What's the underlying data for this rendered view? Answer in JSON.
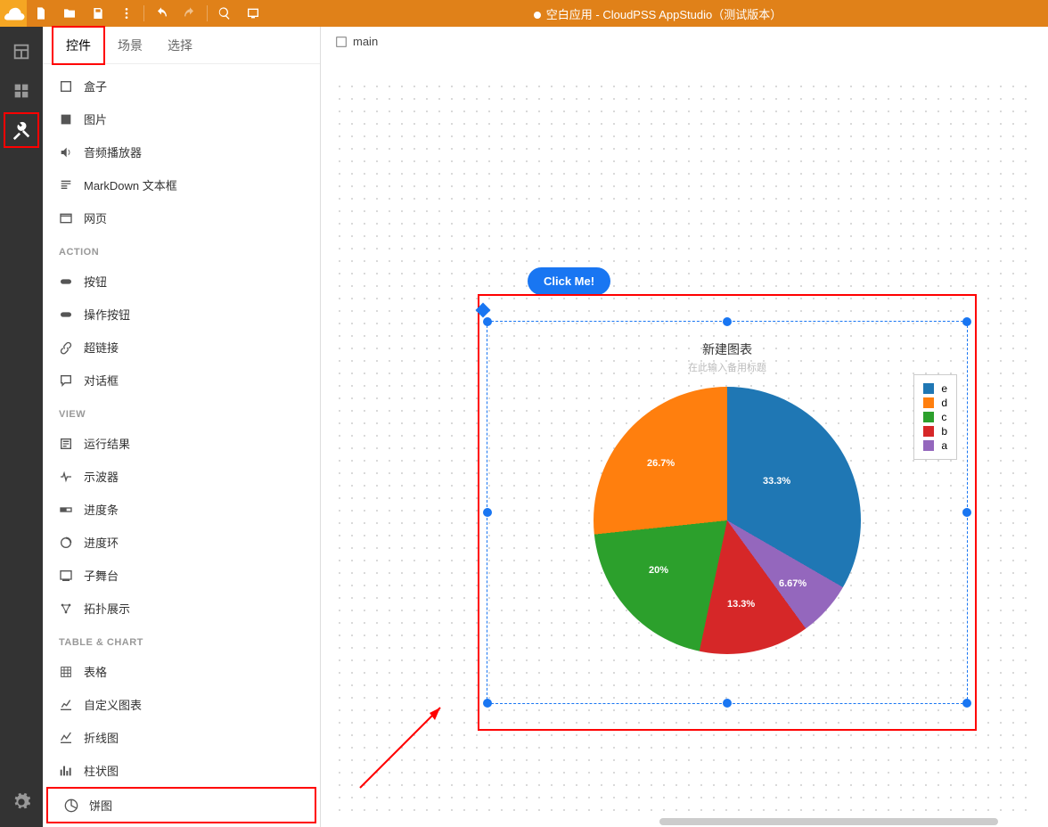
{
  "app_title": "空白应用 - CloudPSS AppStudio（测试版本）",
  "tabs": {
    "widgets": "控件",
    "scenes": "场景",
    "select": "选择"
  },
  "canvas_tab": "main",
  "click_me": "Click Me!",
  "groups": {
    "action": "ACTION",
    "view": "VIEW",
    "table": "TABLE & CHART"
  },
  "widgets": {
    "box": "盒子",
    "image": "图片",
    "audio": "音频播放器",
    "markdown": "MarkDown 文本框",
    "web": "网页",
    "button": "按钮",
    "opbutton": "操作按钮",
    "link": "超链接",
    "dialog": "对话框",
    "result": "运行结果",
    "scope": "示波器",
    "progressbar": "进度条",
    "progressring": "进度环",
    "substage": "子舞台",
    "topo": "拓扑展示",
    "table": "表格",
    "custom": "自定义图表",
    "line": "折线图",
    "bar": "柱状图",
    "pie": "饼图"
  },
  "chart_title": "新建图表",
  "chart_subtitle": "在此输入备用标题",
  "chart_data": {
    "type": "pie",
    "title": "新建图表",
    "series": [
      {
        "name": "e",
        "value": 33.3,
        "percent": "33.3%",
        "color": "#1f77b4"
      },
      {
        "name": "d",
        "value": 26.7,
        "percent": "26.7%",
        "color": "#ff7f0e"
      },
      {
        "name": "c",
        "value": 20.0,
        "percent": "20%",
        "color": "#2ca02c"
      },
      {
        "name": "b",
        "value": 13.3,
        "percent": "13.3%",
        "color": "#d62728"
      },
      {
        "name": "a",
        "value": 6.67,
        "percent": "6.67%",
        "color": "#9467bd"
      }
    ],
    "legend_order": [
      "e",
      "d",
      "c",
      "b",
      "a"
    ]
  }
}
